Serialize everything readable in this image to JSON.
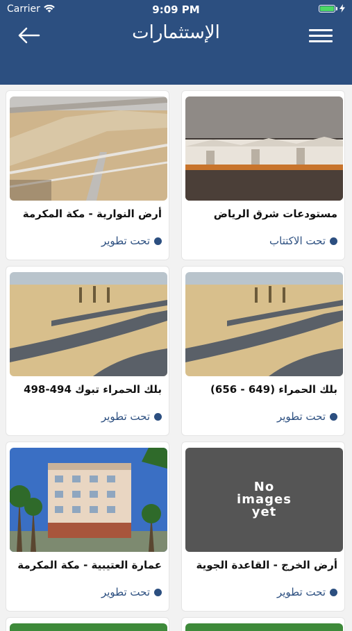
{
  "status_bar": {
    "carrier": "Carrier",
    "time": "9:09 PM"
  },
  "header": {
    "title": "الإستثمارات"
  },
  "projects": [
    {
      "name": "مستودعات شرق الرياض",
      "status": "تحت الاكتتاب",
      "image": "warehouse-photo"
    },
    {
      "name": "أرض النوارية - مكة المكرمة",
      "status": "تحت تطوير",
      "image": "land-photo"
    },
    {
      "name": "بلك الحمراء (649 - 656)",
      "status": "تحت تطوير",
      "image": "land-roads-photo"
    },
    {
      "name": "بلك الحمراء تبوك 494-498",
      "status": "تحت تطوير",
      "image": "land-roads-photo"
    },
    {
      "name": "أرض الخرج - القاعدة الجوية",
      "status": "تحت تطوير",
      "image": "no-image-placeholder"
    },
    {
      "name": "عمارة العتيبية - مكة المكرمة",
      "status": "تحت تطوير",
      "image": "building-photo"
    }
  ],
  "placeholder": {
    "line1": "No",
    "line2": "images",
    "line3": "yet"
  },
  "colors": {
    "primary": "#2c4f80",
    "background": "#f2f2f2"
  }
}
